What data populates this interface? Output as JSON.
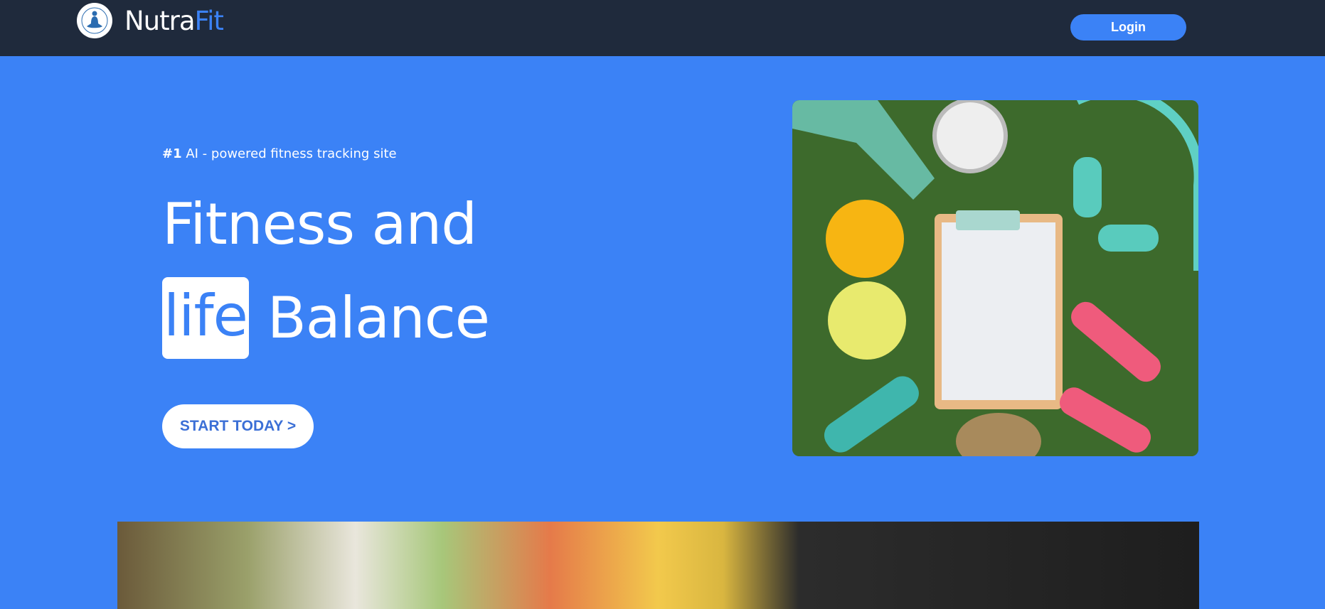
{
  "header": {
    "logo_icon": "meditation-logo-icon",
    "brand_part1": "Nutra",
    "brand_part2": "Fit",
    "login_label": "Login"
  },
  "hero": {
    "tagline_bold": "#1",
    "tagline_rest": " AI - powered fitness tracking site",
    "headline_line1": "Fitness and",
    "headline_highlight": "life",
    "headline_line2_rest": "Balance",
    "cta_label": "START TODAY >",
    "image": "fitness-flatlay-photo"
  },
  "colors": {
    "accent": "#3b82f6",
    "header_bg": "#1f2a3c",
    "text": "#ffffff"
  }
}
